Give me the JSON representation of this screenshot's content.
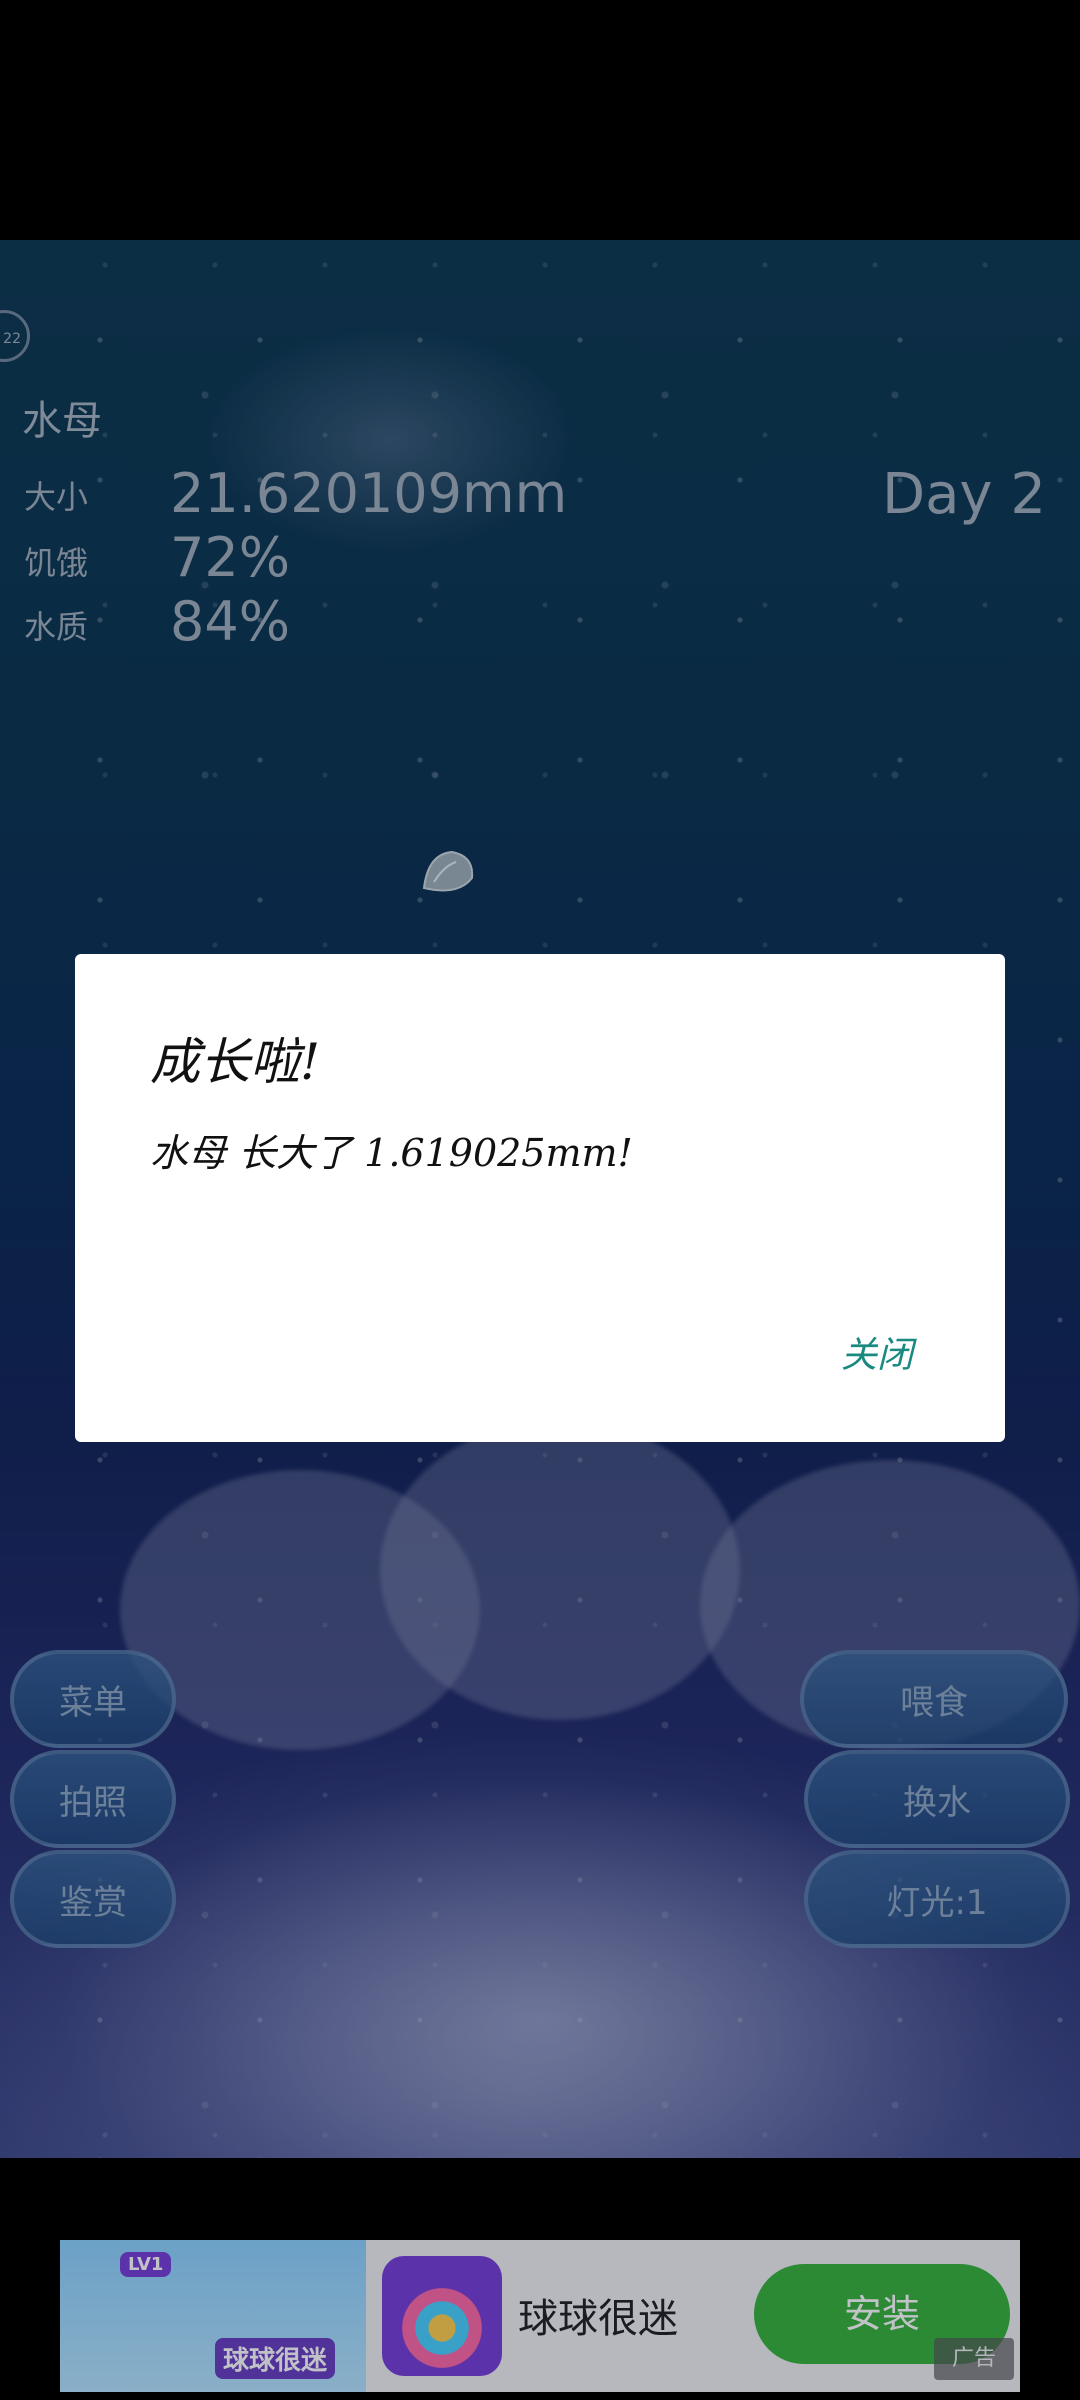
{
  "pet": {
    "name": "水母",
    "labels": {
      "size": "大小",
      "hunger": "饥饿",
      "water": "水质"
    },
    "size": "21.620109mm",
    "hunger": "72%",
    "water": "84%",
    "day": "Day 2",
    "corner_badge": "22"
  },
  "buttons": {
    "menu": "菜单",
    "photo": "拍照",
    "appreciate": "鉴赏",
    "feed": "喂食",
    "change_water": "换水",
    "light": "灯光:1"
  },
  "dialog": {
    "title": "成长啦!",
    "message": "水母 长大了 1.619025mm!",
    "close": "关闭"
  },
  "ad": {
    "image_title": "球球很迷",
    "level_badge": "LV1",
    "app_name": "球球很迷",
    "install": "安装",
    "ad_tag": "广告"
  }
}
